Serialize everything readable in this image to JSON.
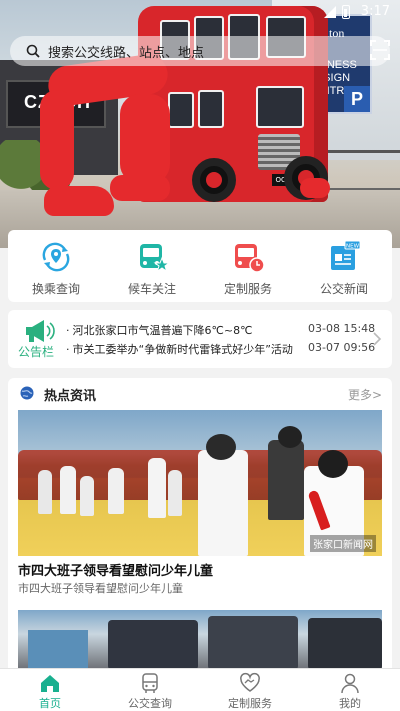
{
  "status_bar": {
    "time": "3:17"
  },
  "search": {
    "placeholder": "搜索公交线路、站点、地点"
  },
  "hero": {
    "left_sign": "CZECH",
    "hotel_brand": "Hilton",
    "hotel_line1": "BUSINESS",
    "hotel_line2": "DESIGN",
    "hotel_line3": "CENTRE",
    "parking": "P"
  },
  "quick_menu": [
    {
      "label": "换乘查询",
      "icon": "route-pin-icon"
    },
    {
      "label": "候车关注",
      "icon": "bus-star-icon"
    },
    {
      "label": "定制服务",
      "icon": "bus-clock-icon"
    },
    {
      "label": "公交新闻",
      "icon": "newspaper-icon",
      "badge": "NEW"
    }
  ],
  "notice": {
    "tag": "公告栏",
    "items": [
      {
        "text": "河北张家口市气温普遍下降6℃~8℃",
        "date": "03-08 15:48"
      },
      {
        "text": "市关工委举办“争做新时代雷锋式好少年”活动",
        "date": "03-07 09:56"
      }
    ]
  },
  "news": {
    "section_title": "热点资讯",
    "more": "更多>",
    "watermark": "张家口新闻网",
    "articles": [
      {
        "title": "市四大班子领导看望慰问少年儿童",
        "summary": "市四大班子领导看望慰问少年儿童"
      }
    ]
  },
  "tabbar": [
    {
      "label": "首页",
      "active": true
    },
    {
      "label": "公交查询",
      "active": false
    },
    {
      "label": "定制服务",
      "active": false
    },
    {
      "label": "我的",
      "active": false
    }
  ],
  "colors": {
    "accent": "#19b08f",
    "bus_red": "#d8262b",
    "notice_green": "#2ab07f"
  }
}
